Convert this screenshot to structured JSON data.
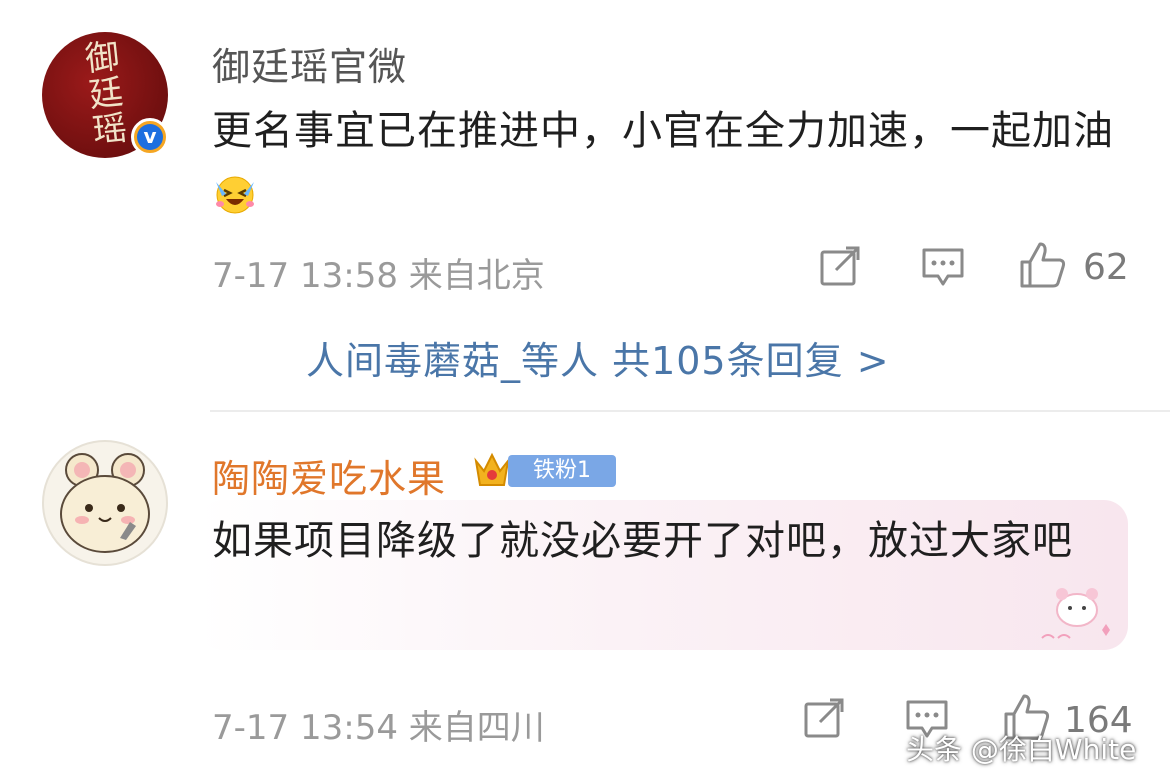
{
  "comments": [
    {
      "avatar_text": "御廷瑶",
      "username": "御廷瑶官微",
      "text": "更名事宜已在推进中，小官在全力加速，一起加油",
      "emoji": "laughing-emoji",
      "meta": "7-17 13:58 来自北京",
      "likes": "62",
      "replies_link": "人间毒蘑菇_等人  共105条回复 >"
    },
    {
      "username": "陶陶爱吃水果",
      "fan_badge": "铁粉1",
      "text": "如果项目降级了就没必要开了对吧，放过大家吧",
      "meta": "7-17 13:54 来自四川",
      "likes": "164"
    }
  ],
  "watermark": "头条 @徐白White",
  "colors": {
    "link": "#4a76a8",
    "username_fan": "#e0772b",
    "meta": "#9a9a9a"
  }
}
